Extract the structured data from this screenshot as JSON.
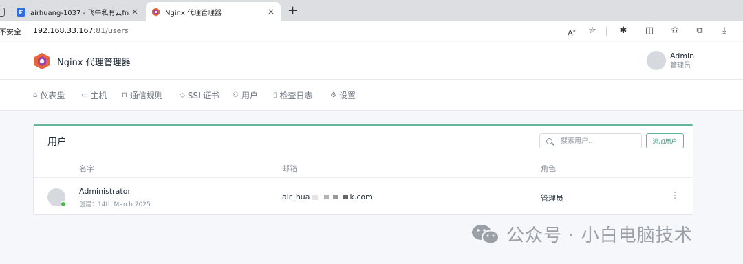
{
  "browser": {
    "tabs": [
      {
        "title": "airhuang-1037 - 飞牛私有云fnOS",
        "active": false
      },
      {
        "title": "Nginx 代理管理器",
        "active": true
      }
    ],
    "close_glyph": "×",
    "new_tab_glyph": "+",
    "security_label": "不安全",
    "url_host": "192.168.33.167",
    "url_rest": ":81/users"
  },
  "app": {
    "brand_name": "Nginx 代理管理器",
    "user": {
      "name": "Admin",
      "role": "管理员"
    }
  },
  "nav": [
    {
      "label": "仪表盘",
      "icon": "home-icon",
      "glyph": "⌂"
    },
    {
      "label": "主机",
      "icon": "monitor-icon",
      "glyph": "▭"
    },
    {
      "label": "通信规则",
      "icon": "lock-icon",
      "glyph": "⊓"
    },
    {
      "label": "SSL证书",
      "icon": "shield-icon",
      "glyph": "◇"
    },
    {
      "label": "用户",
      "icon": "users-icon",
      "glyph": "⚇"
    },
    {
      "label": "检查日志",
      "icon": "book-icon",
      "glyph": "▯"
    },
    {
      "label": "设置",
      "icon": "gear-icon",
      "glyph": "⚙"
    }
  ],
  "users_card": {
    "title": "用户",
    "search_placeholder": "搜索用户…",
    "add_button": "添加用户",
    "columns": {
      "name": "名字",
      "email": "邮箱",
      "role": "角色"
    },
    "rows": [
      {
        "name": "Administrator",
        "created": "创建：14th March 2025",
        "email_visible": "air_hua",
        "email_suffix": "k.com",
        "role": "管理员",
        "status": "online",
        "menu_glyph": "⋮"
      }
    ]
  },
  "watermark": {
    "text": "公众号 · 小白电脑技术"
  },
  "colors": {
    "accent": "#5eba99",
    "online": "#4bb84b",
    "brand_orange": "#e8643c",
    "brand_purple": "#9c3fae"
  }
}
